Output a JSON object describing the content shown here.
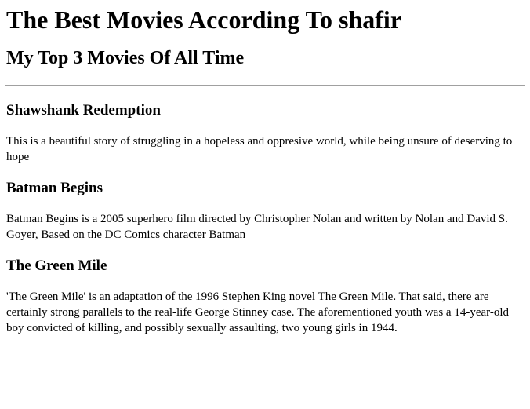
{
  "page": {
    "title": "The Best Movies According To shafir",
    "subtitle": "My Top 3 Movies Of All Time"
  },
  "movies": [
    {
      "title": "Shawshank Redemption",
      "description": "This is a beautiful story of struggling in a hopeless and oppresive world, while being unsure of deserving to hope"
    },
    {
      "title": "Batman Begins",
      "description": "Batman Begins is a 2005 superhero film directed by Christopher Nolan and written by Nolan and David S. Goyer, Based on the DC Comics character Batman"
    },
    {
      "title": "The Green Mile",
      "description": "'The Green Mile' is an adaptation of the 1996 Stephen King novel The Green Mile. That said, there are certainly strong parallels to the real-life George Stinney case. The aforementioned youth was a 14-year-old boy convicted of killing, and possibly sexually assaulting, two young girls in 1944."
    }
  ]
}
